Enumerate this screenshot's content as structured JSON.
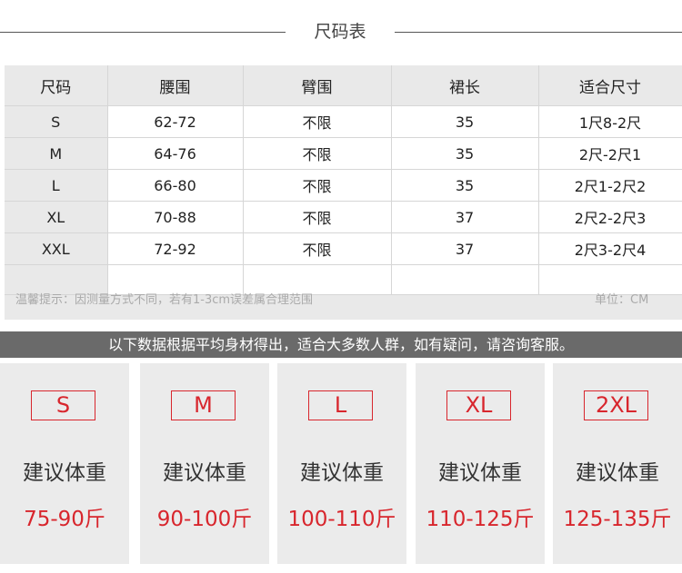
{
  "title": "尺码表",
  "table": {
    "headers": [
      "尺码",
      "腰围",
      "臂围",
      "裙长",
      "适合尺寸"
    ],
    "rows": [
      [
        "S",
        "62-72",
        "不限",
        "35",
        "1尺8-2尺"
      ],
      [
        "M",
        "64-76",
        "不限",
        "35",
        "2尺-2尺1"
      ],
      [
        "L",
        "66-80",
        "不限",
        "35",
        "2尺1-2尺2"
      ],
      [
        "XL",
        "70-88",
        "不限",
        "37",
        "2尺2-2尺3"
      ],
      [
        "XXL",
        "72-92",
        "不限",
        "37",
        "2尺3-2尺4"
      ]
    ]
  },
  "note": {
    "tip": "温馨提示：因测量方式不同，若有1-3cm误差属合理范围",
    "unit": "单位：CM"
  },
  "banner": "以下数据根据平均身材得出，适合大多数人群，如有疑问，请咨询客服。",
  "weights": [
    {
      "size": "S",
      "label": "建议体重",
      "value": "75-90斤"
    },
    {
      "size": "M",
      "label": "建议体重",
      "value": "90-100斤"
    },
    {
      "size": "L",
      "label": "建议体重",
      "value": "100-110斤"
    },
    {
      "size": "XL",
      "label": "建议体重",
      "value": "110-125斤"
    },
    {
      "size": "2XL",
      "label": "建议体重",
      "value": "125-135斤"
    }
  ],
  "colors": {
    "accent": "#d8262d",
    "banner": "#6a6a6a",
    "panel": "#e9e9e9"
  }
}
